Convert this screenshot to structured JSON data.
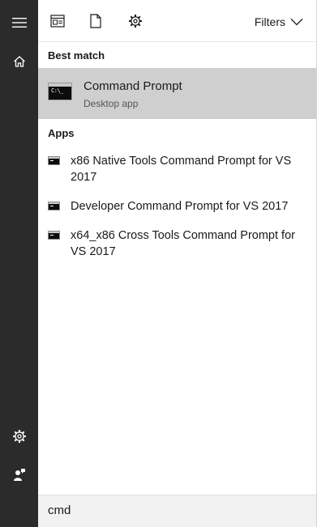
{
  "rail": {
    "items": [
      {
        "name": "hamburger-menu-icon"
      },
      {
        "name": "home-icon"
      },
      {
        "name": "settings-icon"
      },
      {
        "name": "feedback-icon"
      }
    ]
  },
  "toolbar": {
    "icons": [
      "apps-view-icon",
      "documents-icon",
      "settings-icon"
    ],
    "filters_label": "Filters"
  },
  "best_match": {
    "section_label": "Best match",
    "title": "Command Prompt",
    "subtitle": "Desktop app",
    "icon": "cmd-icon"
  },
  "apps": {
    "section_label": "Apps",
    "items": [
      {
        "label": "x86 Native Tools Command Prompt for VS 2017"
      },
      {
        "label": "Developer Command Prompt for VS 2017"
      },
      {
        "label": "x64_x86 Cross Tools Command Prompt for VS 2017"
      }
    ]
  },
  "search": {
    "value": "cmd"
  },
  "colors": {
    "rail_bg": "#2b2b2b",
    "selected_bg": "#cfcfcf",
    "search_bg": "#f2f2f2"
  }
}
